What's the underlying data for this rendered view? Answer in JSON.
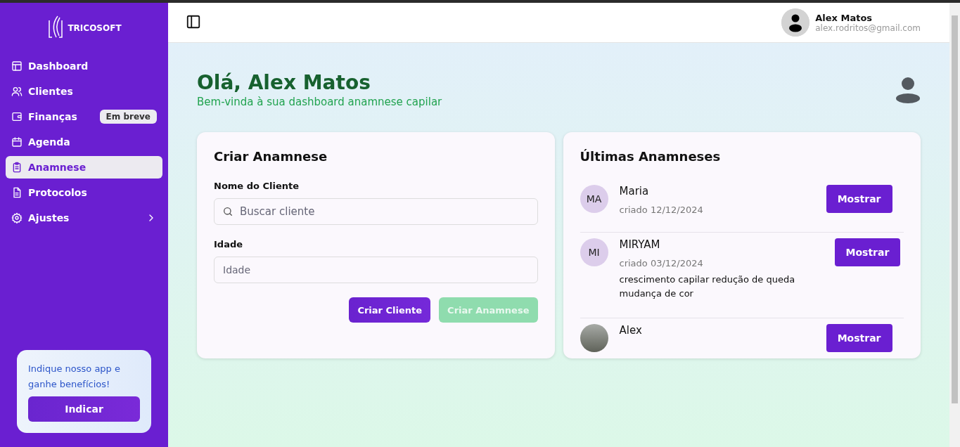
{
  "sidebar": {
    "logo": "TRICOSOFT",
    "items": [
      {
        "label": "Dashboard",
        "selected": false
      },
      {
        "label": "Clientes",
        "selected": false
      },
      {
        "label": "Finanças",
        "selected": false,
        "badge": "Em breve"
      },
      {
        "label": "Agenda",
        "selected": false
      },
      {
        "label": "Anamnese",
        "selected": true
      },
      {
        "label": "Protocolos",
        "selected": false
      },
      {
        "label": "Ajustes",
        "selected": false,
        "submenu": true
      }
    ],
    "promo": {
      "text": "Indique nosso app e ganhe benefícios!",
      "button": "Indicar"
    }
  },
  "header": {
    "user": {
      "name": "Alex Matos",
      "email": "alex.rodritos@gmail.com"
    }
  },
  "greeting": {
    "title": "Olá, Alex Matos",
    "subtitle": "Bem-vinda à sua dashboard anamnese capilar"
  },
  "create_form": {
    "title": "Criar Anamnese",
    "fields": [
      {
        "label": "Nome do Cliente",
        "placeholder": "Buscar cliente",
        "kind": "search"
      },
      {
        "label": "Idade",
        "placeholder": "Idade",
        "kind": "text"
      }
    ],
    "buttons": [
      {
        "label": "Criar Cliente",
        "disabled": false
      },
      {
        "label": "Criar Anamnese",
        "disabled": true
      }
    ]
  },
  "recent": {
    "title": "Últimas Anamneses",
    "items": [
      {
        "avatar": "MA",
        "kind": "initials",
        "name": "Maria",
        "date": "criado 12/12/2024",
        "button": "Mostrar"
      },
      {
        "avatar": "MI",
        "kind": "initials",
        "name": "MIRYAM",
        "date": "criado 03/12/2024",
        "notes": "crescimento capilar redução de queda mudança de cor",
        "button": "Mostrar"
      },
      {
        "kind": "photo",
        "name": "Alex",
        "button": "Mostrar"
      }
    ]
  }
}
